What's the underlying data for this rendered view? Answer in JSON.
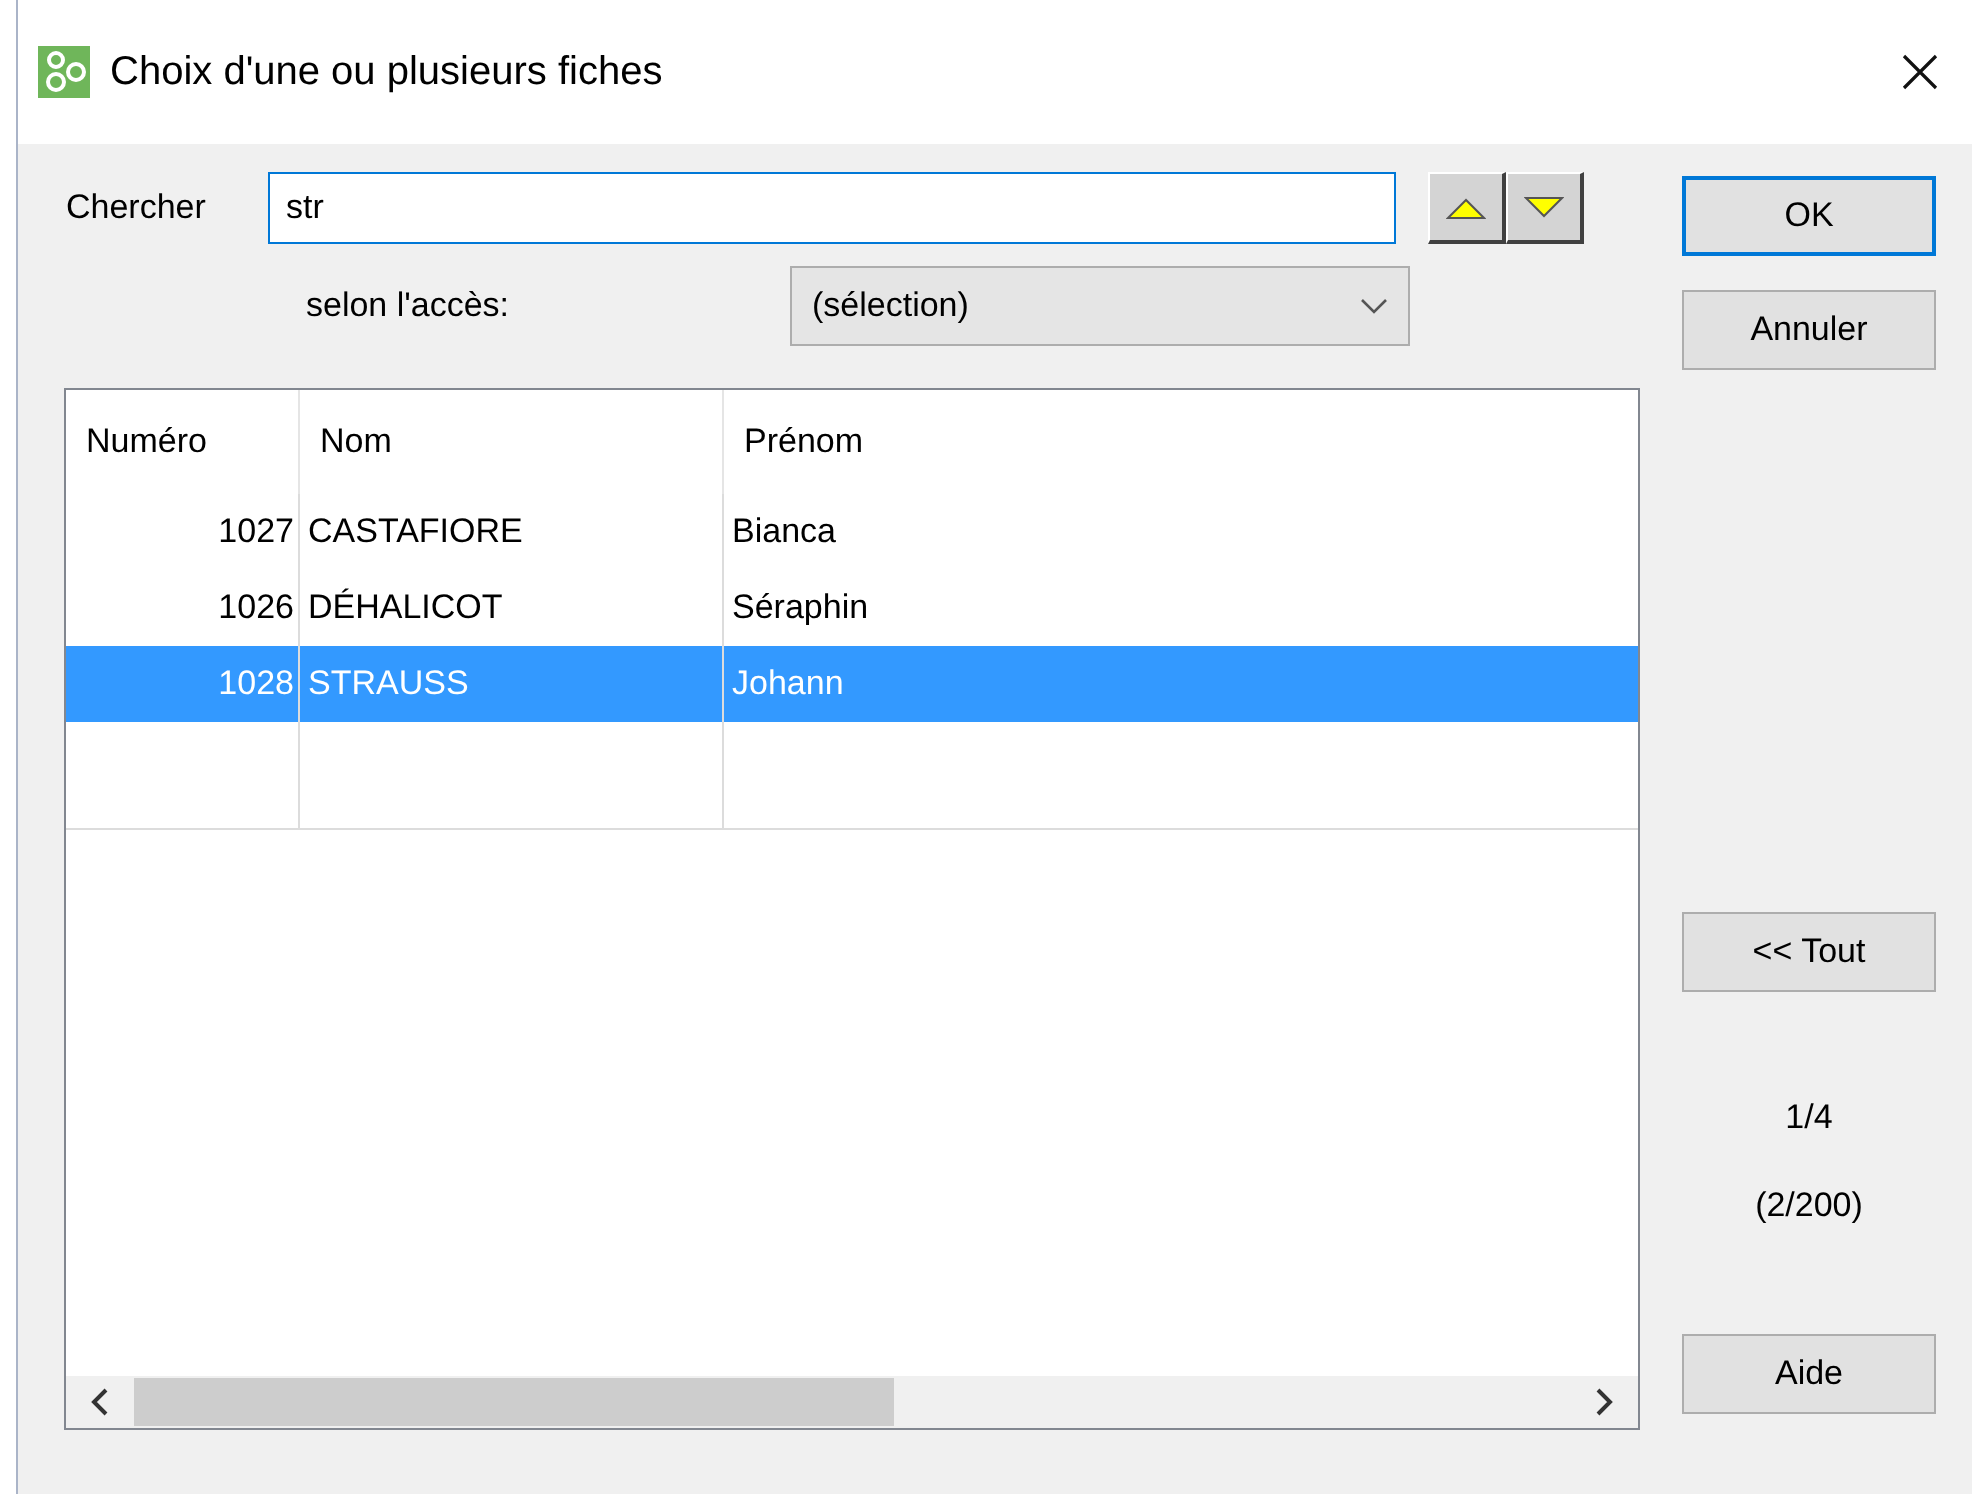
{
  "window": {
    "title": "Choix d'une ou plusieurs fiches"
  },
  "search": {
    "label": "Chercher",
    "value": "str"
  },
  "access": {
    "label": "selon l'accès:",
    "value": "(sélection)"
  },
  "table": {
    "columns": [
      "Numéro",
      "Nom",
      "Prénom"
    ],
    "rows": [
      {
        "cells": [
          "1027",
          "CASTAFIORE",
          "Bianca"
        ],
        "selected": false
      },
      {
        "cells": [
          "1026",
          "DÉHALICOT",
          "Séraphin"
        ],
        "selected": false
      },
      {
        "cells": [
          "1028",
          "STRAUSS",
          "Johann"
        ],
        "selected": true
      }
    ]
  },
  "top_buttons": [
    {
      "label": "OK",
      "default": true
    },
    {
      "label": "Annuler",
      "default": false
    }
  ],
  "all_button": {
    "label": "<< Tout"
  },
  "counter": {
    "page": "1/4",
    "total": "(2/200)"
  },
  "help_button": {
    "label": "Aide"
  }
}
